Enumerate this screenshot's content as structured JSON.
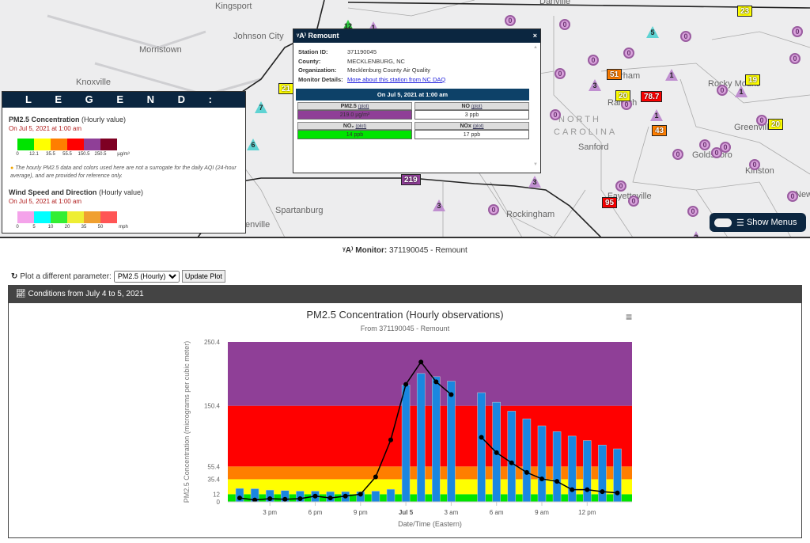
{
  "map": {
    "cities": [
      "Kingsport",
      "Johnson City",
      "Morristown",
      "Knoxville",
      "Spartanburg",
      "enville",
      "Danville",
      "Durham",
      "Raleigh",
      "NORTH",
      "CAROLINA",
      "Sanford",
      "Rocky Mount",
      "Greenville",
      "Goldsboro",
      "Kinston",
      "Fayetteville",
      "Rockingham",
      "New"
    ],
    "markers": [
      {
        "kind": "circ",
        "value": "0"
      },
      {
        "kind": "circ",
        "value": "0"
      },
      {
        "kind": "circ",
        "value": "0"
      },
      {
        "kind": "circ",
        "value": "0"
      },
      {
        "kind": "circ",
        "value": "0"
      },
      {
        "kind": "circ",
        "value": "0"
      },
      {
        "kind": "circ",
        "value": "0"
      },
      {
        "kind": "circ",
        "value": "0"
      },
      {
        "kind": "circ",
        "value": "0"
      },
      {
        "kind": "circ",
        "value": "0"
      },
      {
        "kind": "circ",
        "value": "0"
      },
      {
        "kind": "circ",
        "value": "0"
      },
      {
        "kind": "circ",
        "value": "0"
      },
      {
        "kind": "circ",
        "value": "0"
      },
      {
        "kind": "circ",
        "value": "0"
      },
      {
        "kind": "circ",
        "value": "0"
      },
      {
        "kind": "circ",
        "value": "0"
      },
      {
        "kind": "circ",
        "value": "0"
      },
      {
        "kind": "circ",
        "value": "0"
      },
      {
        "kind": "circ",
        "value": "0"
      },
      {
        "kind": "circ",
        "value": "0"
      },
      {
        "kind": "circ",
        "value": "0"
      },
      {
        "kind": "box",
        "value": "21",
        "color": "#ffff00"
      },
      {
        "kind": "box",
        "value": "23",
        "color": "#ffff00"
      },
      {
        "kind": "box",
        "value": "51",
        "color": "#ff7e00"
      },
      {
        "kind": "box",
        "value": "20",
        "color": "#ffff00"
      },
      {
        "kind": "box",
        "value": "78.7",
        "color": "#ff0000"
      },
      {
        "kind": "box",
        "value": "43",
        "color": "#ff7e00"
      },
      {
        "kind": "box",
        "value": "19",
        "color": "#ffff00"
      },
      {
        "kind": "box",
        "value": "20",
        "color": "#ffff00"
      },
      {
        "kind": "box",
        "value": "95",
        "color": "#ff0000"
      },
      {
        "kind": "box",
        "value": "219",
        "color": "#8f3f97"
      },
      {
        "kind": "tri",
        "value": "12",
        "color": "#2ecc40"
      },
      {
        "kind": "tri",
        "value": "1",
        "color": "#c08fd0"
      },
      {
        "kind": "tri",
        "value": "7",
        "color": "#5fd3d3"
      },
      {
        "kind": "tri",
        "value": "6",
        "color": "#5fd3d3"
      },
      {
        "kind": "tri",
        "value": "3",
        "color": "#c08fd0"
      },
      {
        "kind": "tri",
        "value": "5",
        "color": "#5fd3d3"
      },
      {
        "kind": "tri",
        "value": "1",
        "color": "#c08fd0"
      },
      {
        "kind": "tri",
        "value": "3",
        "color": "#c08fd0"
      },
      {
        "kind": "tri",
        "value": "3",
        "color": "#c08fd0"
      },
      {
        "kind": "tri",
        "value": "1",
        "color": "#c08fd0"
      },
      {
        "kind": "tri",
        "value": "1",
        "color": "#c08fd0"
      },
      {
        "kind": "tri",
        "value": "3",
        "color": "#c08fd0"
      }
    ]
  },
  "legend": {
    "title": "L E G E N D :",
    "pm": {
      "title": "PM2.5 Concentration",
      "qual": "(Hourly value)",
      "date": "On Jul 5, 2021 at 1:00 am",
      "colors": [
        "#00e400",
        "#ffff00",
        "#ff7e00",
        "#ff0000",
        "#8f3f97",
        "#7e0023"
      ],
      "ticks": [
        "0",
        "12.1",
        "35.5",
        "55.5",
        "150.5",
        "250.5",
        "µg/m³"
      ]
    },
    "note": "The hourly PM2.5 data and colors used here are not a surrogate for the daily AQI (24-hour average), and are provided for reference only.",
    "wind": {
      "title": "Wind Speed and Direction",
      "qual": "(Hourly value)",
      "date": "On Jul 5, 2021 at 1:00 am",
      "colors": [
        "#f4a3ea",
        "#00ffff",
        "#33ee33",
        "#eeee33",
        "#f0a030",
        "#ff5555"
      ],
      "ticks": [
        "0",
        "5",
        "10",
        "20",
        "35",
        "50",
        "mph"
      ]
    }
  },
  "popup": {
    "title": "Remount",
    "close": "×",
    "station_id_label": "Station ID:",
    "station_id": "371190045",
    "county_label": "County:",
    "county": "MECKLENBURG, NC",
    "org_label": "Organization:",
    "org": "Mecklenburg County Air Quality",
    "details_label": "Monitor Details:",
    "details_link": "More about this station from NC DAQ",
    "obs_header": "On Jul 5, 2021 at 1:00 am",
    "plot_link": "(plot)",
    "cells": [
      {
        "label": "PM2.5",
        "value": "219.0 µg/m³",
        "color": "#8f3f97"
      },
      {
        "label": "NO",
        "value": "3 ppb",
        "color": "#ffffff"
      },
      {
        "label": "NO₂",
        "value": "14 ppb",
        "color": "#00e400"
      },
      {
        "label": "NOx",
        "value": "17 ppb",
        "color": "#ffffff"
      }
    ]
  },
  "show_menus": "Show Menus",
  "monitor": {
    "label": "Monitor:",
    "value": "371190045 - Remount"
  },
  "plot_controls": {
    "label": "Plot a different parameter:",
    "selected": "PM2.5 (Hourly)",
    "button": "Update Plot"
  },
  "conditions": "Conditions from July 4 to 5, 2021",
  "chart_data": {
    "type": "bar+line",
    "title": "PM2.5 Concentration (Hourly observations)",
    "subtitle": "From 371190045 - Remount",
    "xlabel": "Date/Time (Eastern)",
    "ylabel": "PM2.5 Concentration (micrograms per cubic meter)",
    "ylim": [
      0,
      250.4
    ],
    "yticks": [
      0,
      12,
      35.4,
      55.4,
      150.4,
      250.4
    ],
    "bands": [
      {
        "from": 0,
        "to": 12,
        "color": "#00e400"
      },
      {
        "from": 12,
        "to": 35.4,
        "color": "#ffff00"
      },
      {
        "from": 35.4,
        "to": 55.4,
        "color": "#ff7e00"
      },
      {
        "from": 55.4,
        "to": 150.4,
        "color": "#ff0000"
      },
      {
        "from": 150.4,
        "to": 250.4,
        "color": "#8f3f97"
      }
    ],
    "x": [
      "Jul 4 1 pm",
      "2 pm",
      "3 pm",
      "4 pm",
      "5 pm",
      "6 pm",
      "7 pm",
      "8 pm",
      "9 pm",
      "10 pm",
      "11 pm",
      "Jul 5 12 am",
      "1 am",
      "2 am",
      "3 am",
      "4 am",
      "5 am",
      "6 am",
      "7 am",
      "8 am",
      "9 am",
      "10 am",
      "11 am",
      "12 pm",
      "1 pm",
      "2 pm"
    ],
    "xticks": [
      {
        "label": "3 pm",
        "i": 2
      },
      {
        "label": "6 pm",
        "i": 5
      },
      {
        "label": "9 pm",
        "i": 8
      },
      {
        "label": "Jul 5",
        "i": 11,
        "bold": true
      },
      {
        "label": "3 am",
        "i": 14
      },
      {
        "label": "6 am",
        "i": 17
      },
      {
        "label": "9 am",
        "i": 20
      },
      {
        "label": "12 pm",
        "i": 23
      }
    ],
    "series": [
      {
        "type": "bar",
        "color": "#1a87e0",
        "values": [
          21,
          20.5,
          18.5,
          17.7,
          16.8,
          16.8,
          16,
          16,
          16,
          16.8,
          19.7,
          183,
          201,
          196,
          189,
          null,
          171,
          156,
          142,
          130,
          119,
          110,
          103,
          96,
          89,
          83
        ]
      },
      {
        "type": "line",
        "color": "#000000",
        "values": [
          6,
          3,
          5,
          4,
          5,
          9,
          6,
          9,
          12,
          39,
          97,
          184,
          219,
          188,
          168,
          null,
          101,
          77,
          61,
          46,
          36,
          32,
          19,
          19,
          16,
          14
        ]
      }
    ]
  }
}
